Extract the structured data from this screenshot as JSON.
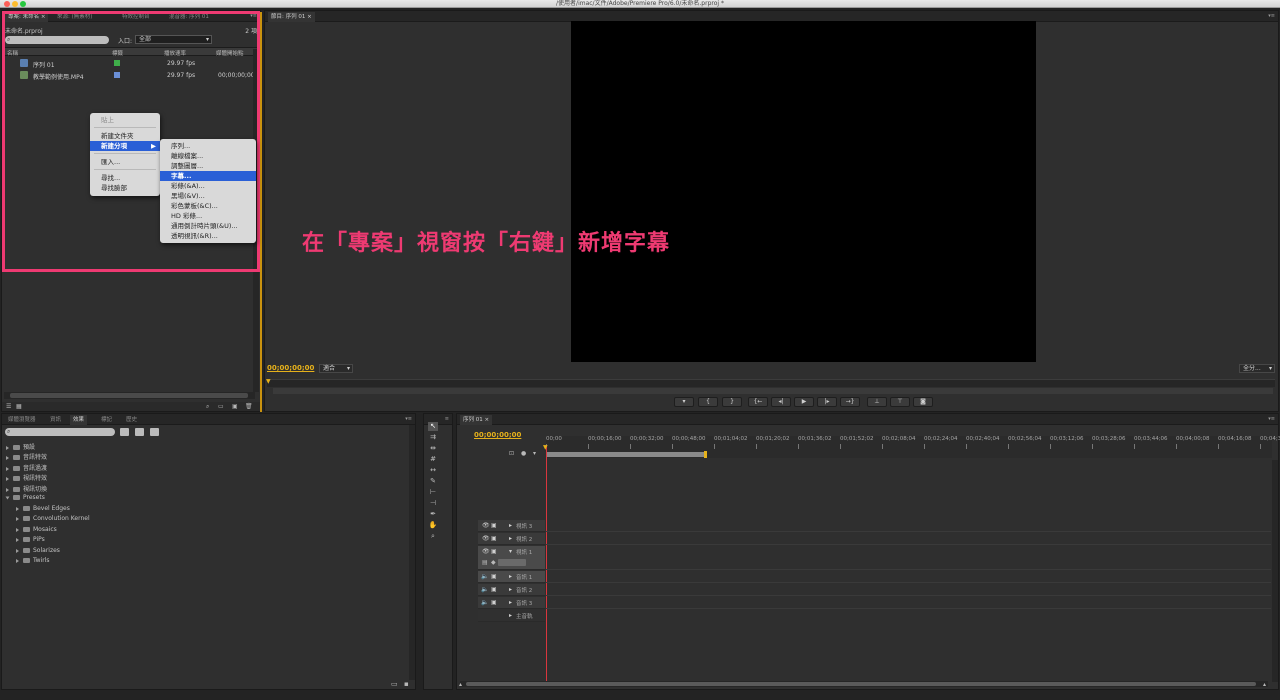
{
  "window": {
    "title": "/使用者/imac/文件/Adobe/Premiere Pro/6.0/未命名.prproj *"
  },
  "colors": {
    "highlight_border": "#ee3a72",
    "accent_timecode": "#e6b11b",
    "annotation": "#ee3a72",
    "menu_selection": "#2a5fd6"
  },
  "project_panel": {
    "tabs": [
      "專案: 未命名 ×",
      "來源: (無素材)",
      "特效控制台",
      "混音器: 序列 01"
    ],
    "file_name": "未命名.prproj",
    "item_count": "2 項",
    "search_placeholder": "",
    "entry_label": "入口:",
    "entry_value": "全部",
    "columns": [
      "名稱",
      "標籤",
      "播放速率",
      "媒體開始點"
    ],
    "items": [
      {
        "name": "序列 01",
        "rate": "29.97 fps",
        "start": "",
        "label_color": "#3fae4a"
      },
      {
        "name": "教學範例使用.MP4",
        "rate": "29.97 fps",
        "start": "00;00;00;00",
        "label_color": "#6b8fd6"
      }
    ]
  },
  "context_menu": {
    "items": [
      {
        "label": "貼上",
        "disabled": true
      },
      {
        "label": "新建文件夾"
      },
      {
        "label": "新建分項",
        "selected": true,
        "submenu": true
      },
      {
        "label": "匯入..."
      },
      {
        "label": "尋找..."
      },
      {
        "label": "尋找臉部"
      }
    ]
  },
  "submenu": {
    "items": [
      "序列...",
      "離線檔案...",
      "調整圖層...",
      "字幕...",
      "彩條(&A)...",
      "黑場(&V)...",
      "彩色蒙板(&C)...",
      "HD 彩條...",
      "通用倒計時片頭(&U)...",
      "透明視訊(&R)..."
    ],
    "selected_index": 3
  },
  "program_monitor": {
    "tab": "節目: 序列 01 ×",
    "timecode": "00;00;00;00",
    "fit_label": "適合",
    "quality_label": "全分..."
  },
  "annotation": {
    "text": "在「專案」視窗按「右鍵」新增字幕"
  },
  "effects_panel": {
    "tabs": [
      "媒體瀏覽器",
      "資訊",
      "效果",
      "標記",
      "歷史"
    ],
    "folders": [
      "預設",
      "音訊特效",
      "音訊過渡",
      "視訊特效",
      "視訊切換"
    ],
    "presets_folder": "Presets",
    "presets": [
      "Bevel Edges",
      "Convolution Kernel",
      "Mosaics",
      "PiPs",
      "Solarizes",
      "Twirls"
    ]
  },
  "timeline": {
    "tab": "序列 01 ×",
    "timecode": "00;00;00;00",
    "ruler": [
      "00;00",
      "00;00;16;00",
      "00;00;32;00",
      "00;00;48;00",
      "00;01;04;02",
      "00;01;20;02",
      "00;01;36;02",
      "00;01;52;02",
      "00;02;08;04",
      "00;02;24;04",
      "00;02;40;04",
      "00;02;56;04",
      "00;03;12;06",
      "00;03;28;06",
      "00;03;44;06",
      "00;04;00;08",
      "00;04;16;08",
      "00;04;32"
    ],
    "video_tracks": [
      "視訊 3",
      "視訊 2",
      "視訊 1"
    ],
    "audio_tracks": [
      "音訊 1",
      "音訊 2",
      "音訊 3"
    ],
    "master": "主音軌"
  }
}
